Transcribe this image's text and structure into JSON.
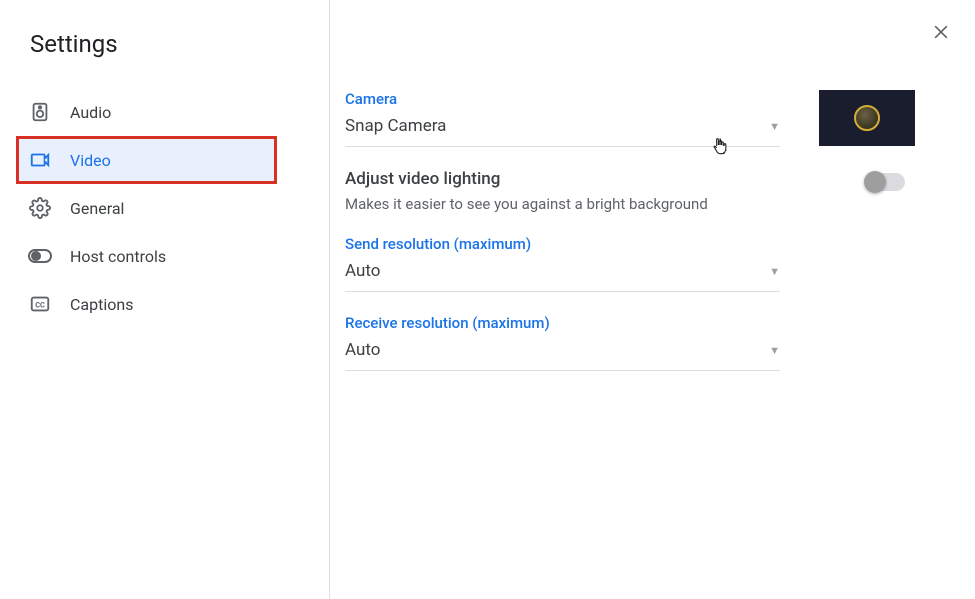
{
  "title": "Settings",
  "sidebar": {
    "items": [
      {
        "label": "Audio"
      },
      {
        "label": "Video"
      },
      {
        "label": "General"
      },
      {
        "label": "Host controls"
      },
      {
        "label": "Captions"
      }
    ]
  },
  "video": {
    "camera_label": "Camera",
    "camera_value": "Snap Camera",
    "lighting_title": "Adjust video lighting",
    "lighting_sub": "Makes it easier to see you against a bright background",
    "send_label": "Send resolution (maximum)",
    "send_value": "Auto",
    "receive_label": "Receive resolution (maximum)",
    "receive_value": "Auto"
  }
}
